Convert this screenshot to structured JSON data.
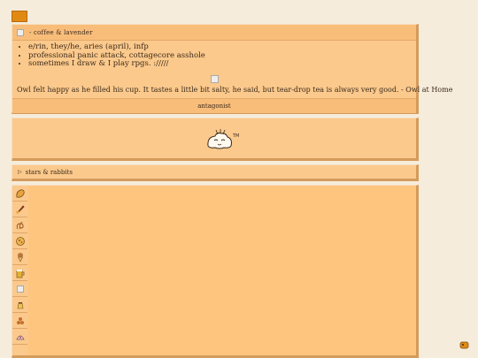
{
  "header": {
    "title": "- coffee & lavender"
  },
  "profile": {
    "facts": [
      "e/rin, they/he, aries (april), infp",
      "professional panic attack, cottagecore asshole",
      "sometimes I draw & I play rpgs. ://///"
    ],
    "quote": "Owl felt happy as he filled his cup. It tastes a little bit salty, he said, but tear-drop tea is always very good. - Owl at Home",
    "sub_label": "antagonist"
  },
  "details": {
    "summary": "stars & rabbits"
  },
  "sidebar_icons": [
    {
      "name": "bread-icon",
      "color": "#e8a33d"
    },
    {
      "name": "rocket-icon",
      "color": "#d9572b"
    },
    {
      "name": "pretzel-icon",
      "color": "#c48c3e"
    },
    {
      "name": "pizza-icon",
      "color": "#e5b64c"
    },
    {
      "name": "ice-cream-icon",
      "color": "#b8783a"
    },
    {
      "name": "beer-icon",
      "color": "#e6b22f"
    },
    {
      "name": "broken-image-icon",
      "color": "#a9a9a9"
    },
    {
      "name": "pudding-icon",
      "color": "#f0c253"
    },
    {
      "name": "peanuts-icon",
      "color": "#c3702c"
    },
    {
      "name": "dumpling-icon",
      "color": "#e9d5c1"
    }
  ],
  "colors": {
    "page_bg": "#f6ecdb",
    "panel_bg": "#fbc98c",
    "panel_head": "#f9bd7a",
    "accent": "#e08a14"
  }
}
